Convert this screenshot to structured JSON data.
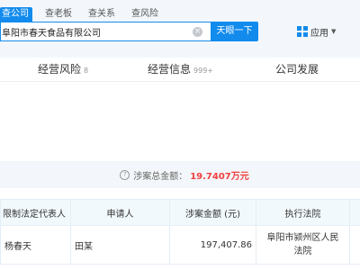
{
  "header": {
    "scope_tabs": [
      {
        "label": "查公司",
        "active": true
      },
      {
        "label": "查老板",
        "active": false
      },
      {
        "label": "查关系",
        "active": false
      },
      {
        "label": "查风险",
        "active": false
      }
    ],
    "search": {
      "value": "阜阳市春天食品有限公司",
      "clear": "×"
    },
    "search_button": "天眼一下",
    "apps_label": "应用",
    "apps_caret": "▼"
  },
  "nav": {
    "items": [
      {
        "label": "经营风险",
        "count": "8"
      },
      {
        "label": "经营信息",
        "count": "999+"
      },
      {
        "label": "公司发展",
        "count": ""
      }
    ]
  },
  "summary": {
    "icon": "?",
    "label": "涉案总金额：",
    "amount": "19.7407万元"
  },
  "table": {
    "headers": [
      "限制法定代表人",
      "申请人",
      "涉案金额 (元)",
      "执行法院",
      ""
    ],
    "rows": [
      {
        "person": "杨春天",
        "applicant": "田某",
        "amount": "197,407.86",
        "court_line1": "阜阳市颍州区人民",
        "court_line2": "法院"
      }
    ]
  },
  "colors": {
    "accent": "#128bed",
    "amount_red": "#f04040"
  }
}
